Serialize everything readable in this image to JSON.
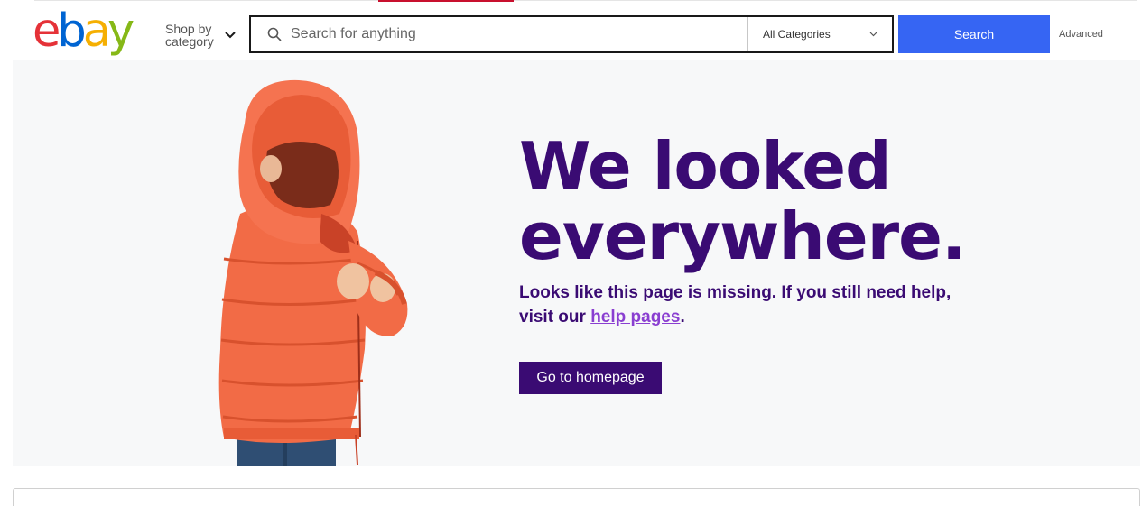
{
  "header": {
    "logo_letters": [
      {
        "char": "e",
        "color": "#e53238"
      },
      {
        "char": "b",
        "color": "#0064d2"
      },
      {
        "char": "a",
        "color": "#f5af02"
      },
      {
        "char": "y",
        "color": "#86b817"
      }
    ],
    "shop_by_category": "Shop by category",
    "search": {
      "placeholder": "Search for anything",
      "value": "",
      "category_selected": "All Categories",
      "button_label": "Search"
    },
    "advanced_label": "Advanced"
  },
  "hero": {
    "headline_line1": "We looked",
    "headline_line2": "everywhere.",
    "message_before_link": "Looks like this page is missing. If you still need help, visit our ",
    "help_link": "help pages",
    "message_after_link": ".",
    "cta_label": "Go to homepage"
  },
  "colors": {
    "search_button": "#3665f3",
    "headline": "#3a0b73",
    "help_link": "#8a3fd1",
    "hero_background": "#f7f8f9"
  }
}
